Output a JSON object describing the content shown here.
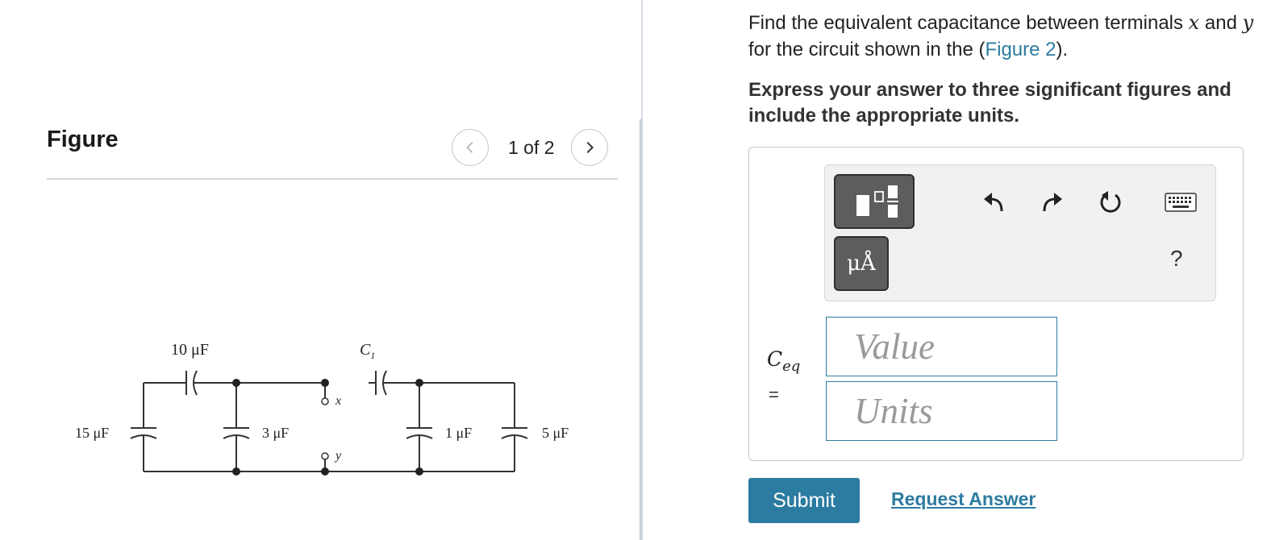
{
  "figure_panel": {
    "title": "Figure",
    "pager_text": "1 of 2",
    "prev_icon": "chevron-left-icon",
    "next_icon": "chevron-right-icon"
  },
  "circuit": {
    "labels": {
      "c_top_left": "10 μF",
      "c_top_right": "C",
      "c_top_right_subscript": "1",
      "c_left": "15 μF",
      "c_mid_left": "3 μF",
      "c_mid_right": "1 μF",
      "c_right": "5 μF",
      "terminal_x": "x",
      "terminal_y": "y"
    }
  },
  "question": {
    "line1_pre": "Find the equivalent capacitance between terminals ",
    "var_x": "x",
    "line1_mid": " and ",
    "var_y": "y",
    "line1_post": " for the circuit shown in the (",
    "figure_link": "Figure 2",
    "line1_end": ")."
  },
  "instruction": "Express your answer to three significant figures and include the appropriate units.",
  "answer": {
    "label_main": "C",
    "label_sub": "eq",
    "equals": "=",
    "value_placeholder": "Value",
    "units_placeholder": "Units"
  },
  "toolbar": {
    "units_button_label": "μÅ",
    "help_label": "?",
    "icons": [
      "templates-icon",
      "undo-icon",
      "redo-icon",
      "reset-icon",
      "keyboard-icon"
    ]
  },
  "actions": {
    "submit_label": "Submit",
    "request_label": "Request Answer"
  },
  "colors": {
    "accent": "#2c7ba0",
    "toolbar_button": "#5d5d5d",
    "divider": "#d5dde4"
  }
}
